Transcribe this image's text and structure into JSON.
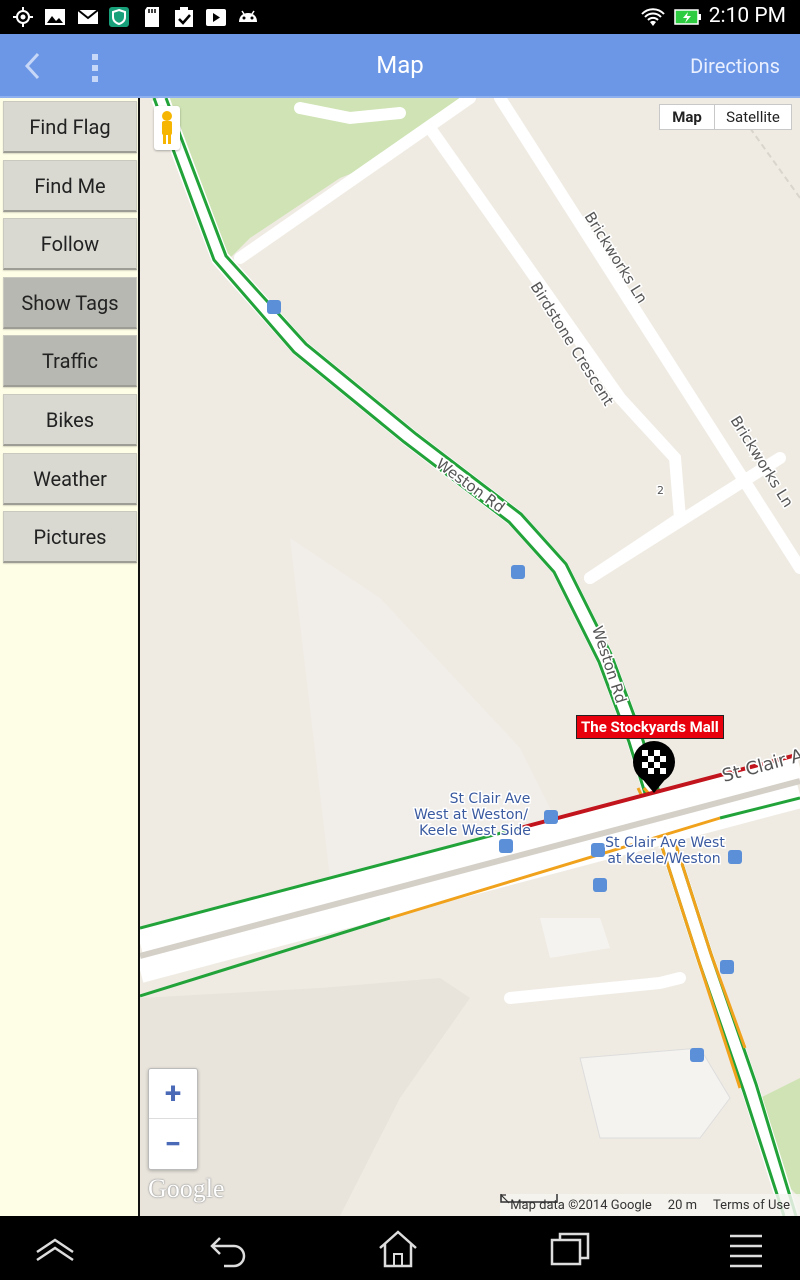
{
  "status_bar": {
    "time": "2:10 PM",
    "icons": [
      "gps-icon",
      "image-icon",
      "mail-icon",
      "shield-app-icon",
      "sd-card-icon",
      "checkbox-icon",
      "play-store-icon",
      "android-icon",
      "wifi-icon",
      "battery-charging-icon"
    ]
  },
  "app_bar": {
    "title": "Map",
    "directions_label": "Directions"
  },
  "sidebar": {
    "items": [
      {
        "label": "Find Flag",
        "active": false
      },
      {
        "label": "Find Me",
        "active": false
      },
      {
        "label": "Follow",
        "active": false
      },
      {
        "label": "Show Tags",
        "active": true
      },
      {
        "label": "Traffic",
        "active": true
      },
      {
        "label": "Bikes",
        "active": false
      },
      {
        "label": "Weather",
        "active": false
      },
      {
        "label": "Pictures",
        "active": false
      }
    ]
  },
  "map": {
    "type_controls": {
      "map": "Map",
      "satellite": "Satellite",
      "selected": "map"
    },
    "zoom_in": "+",
    "zoom_out": "−",
    "marker_label": "The Stockyards Mall",
    "street_labels": {
      "weston_rd_1": "Weston Rd",
      "weston_rd_2": "Weston Rd",
      "birdstone": "Birdstone Crescent",
      "brickworks_1": "Brickworks Ln",
      "brickworks_2": "Brickworks Ln",
      "st_clair": "St Clair Ave"
    },
    "stop_labels": {
      "stop1_line1": "St Clair Ave",
      "stop1_line2": "West at Weston/",
      "stop1_line3": "Keele West Side",
      "stop2_line1": "St Clair Ave West",
      "stop2_line2": "at Keele/Weston"
    },
    "house_number": "2",
    "attribution": {
      "map_data": "Map data ©2014 Google",
      "scale": "20 m",
      "terms": "Terms of Use"
    },
    "logo_text": "Google",
    "colors": {
      "traffic_green": "#22a33a",
      "traffic_orange": "#f0a21c",
      "traffic_red": "#c2141c"
    }
  }
}
